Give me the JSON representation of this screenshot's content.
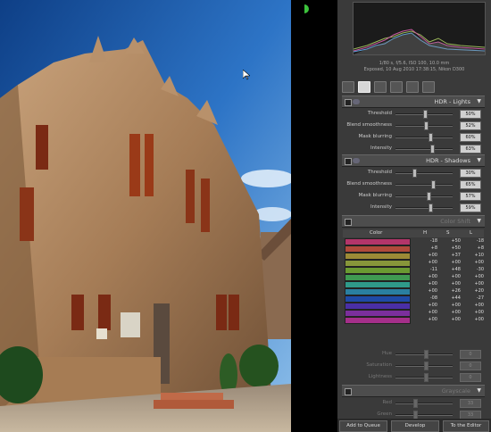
{
  "exif": {
    "line1": "1/80 s, f/5.6, ISO 100, 10.0 mm",
    "line2": "Exposed, 10 Aug 2010 17:38:15, Nikon D300"
  },
  "tools": [
    {
      "name": "crop-tool-icon",
      "active": false
    },
    {
      "name": "adjust-tool-icon",
      "active": true
    },
    {
      "name": "detail-tool-icon",
      "active": false
    },
    {
      "name": "film-tool-icon",
      "active": false
    },
    {
      "name": "frame-tool-icon",
      "active": false
    },
    {
      "name": "settings-tool-icon",
      "active": false
    }
  ],
  "hdr_lights": {
    "title": "HDR - Lights",
    "rows": [
      {
        "label": "Threshold",
        "value": "50%",
        "level": 0.5
      },
      {
        "label": "Blend smoothness",
        "value": "52%",
        "level": 0.52
      },
      {
        "label": "Mask blurring",
        "value": "60%",
        "level": 0.6
      },
      {
        "label": "Intensity",
        "value": "63%",
        "level": 0.63
      }
    ]
  },
  "hdr_shadows": {
    "title": "HDR - Shadows",
    "rows": [
      {
        "label": "Threshold",
        "value": "30%",
        "level": 0.3
      },
      {
        "label": "Blend smoothness",
        "value": "65%",
        "level": 0.65
      },
      {
        "label": "Mask blurring",
        "value": "57%",
        "level": 0.57
      },
      {
        "label": "Intensity",
        "value": "59%",
        "level": 0.59
      }
    ]
  },
  "color_shift": {
    "title": "Color Shift",
    "headers": {
      "color": "Color",
      "h": "H",
      "s": "S",
      "l": "L"
    },
    "rows": [
      {
        "color": "#b3356a",
        "h": "-18",
        "s": "+50",
        "l": "-18"
      },
      {
        "color": "#b04a3b",
        "h": "+8",
        "s": "+50",
        "l": "+8"
      },
      {
        "color": "#9c8a36",
        "h": "+00",
        "s": "+37",
        "l": "+10"
      },
      {
        "color": "#87963a",
        "h": "+00",
        "s": "+00",
        "l": "+00"
      },
      {
        "color": "#6a9a32",
        "h": "-11",
        "s": "+48",
        "l": "-30"
      },
      {
        "color": "#3f9a52",
        "h": "+00",
        "s": "+00",
        "l": "+00"
      },
      {
        "color": "#2f9a8a",
        "h": "+00",
        "s": "+00",
        "l": "+00"
      },
      {
        "color": "#2a7fa0",
        "h": "+00",
        "s": "+26",
        "l": "+20"
      },
      {
        "color": "#1f4aa6",
        "h": "-08",
        "s": "+44",
        "l": "-27"
      },
      {
        "color": "#4a2fa6",
        "h": "+00",
        "s": "+00",
        "l": "+00"
      },
      {
        "color": "#7b2f9c",
        "h": "+00",
        "s": "+00",
        "l": "+00"
      },
      {
        "color": "#a52f8a",
        "h": "+00",
        "s": "+00",
        "l": "+00"
      }
    ],
    "hue_label": "Hue",
    "hue_value": "0",
    "sat_label": "Saturation",
    "sat_value": "0",
    "light_label": "Lightness",
    "light_value": "0"
  },
  "grayscale": {
    "title": "Grayscale",
    "red_label": "Red",
    "red_value": "33",
    "green_label": "Green",
    "green_value": "33"
  },
  "buttons": {
    "add_queue": "Add to Queue",
    "develop": "Develop",
    "editor": "To the Editor"
  },
  "colors": {
    "panel": "#3a3a3a",
    "accent": "#d0d0d0",
    "status_green": "#3cc23c"
  }
}
